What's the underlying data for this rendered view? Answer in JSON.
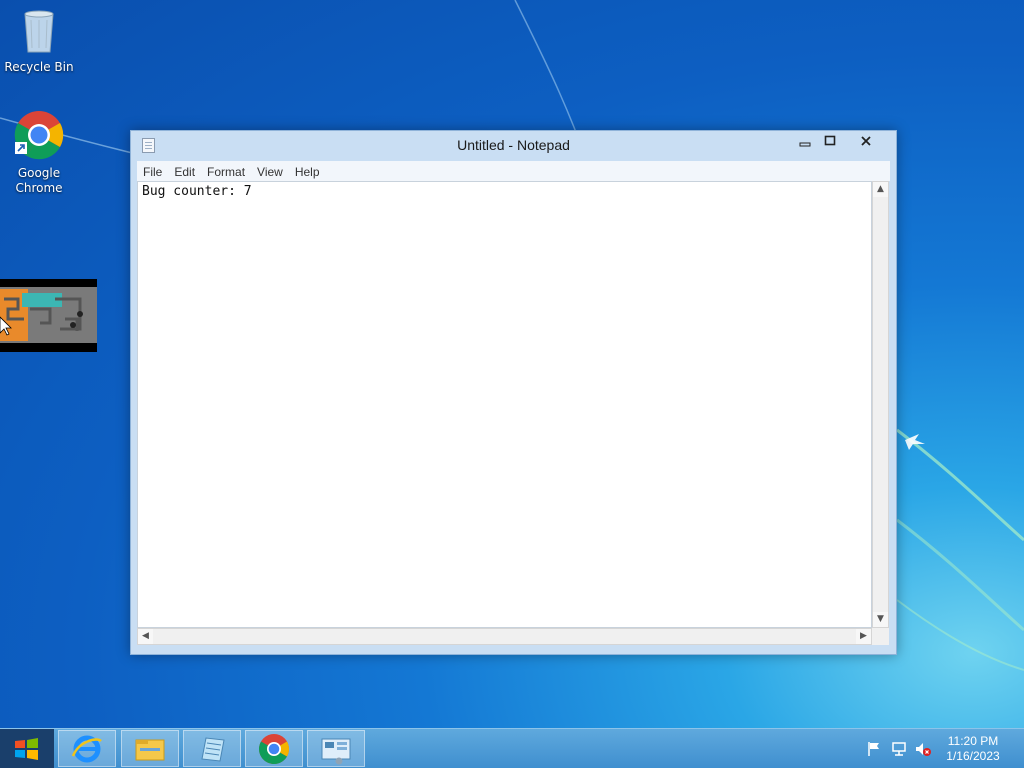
{
  "desktop": {
    "icons": [
      {
        "label": "Recycle Bin",
        "icon": "recycle-bin-icon"
      },
      {
        "label": "Google Chrome",
        "icon": "chrome-icon"
      }
    ]
  },
  "notepad": {
    "title": "Untitled - Notepad",
    "menu": [
      "File",
      "Edit",
      "Format",
      "View",
      "Help"
    ],
    "content": "Bug counter: 7",
    "buttons": {
      "minimize": "minimize-icon",
      "maximize": "maximize-icon",
      "close": "close-icon"
    }
  },
  "taskbar": {
    "pinned": [
      "internet-explorer-icon",
      "file-explorer-icon",
      "notepad-icon",
      "chrome-icon",
      "control-panel-icon"
    ],
    "tray": [
      "flag-icon",
      "network-icon",
      "volume-muted-icon"
    ],
    "clock": {
      "time": "11:20 PM",
      "date": "1/16/2023"
    }
  },
  "colors": {
    "accent": "#1478d4",
    "taskbar": "#4a9ad6",
    "window_frame": "#c9def3"
  }
}
